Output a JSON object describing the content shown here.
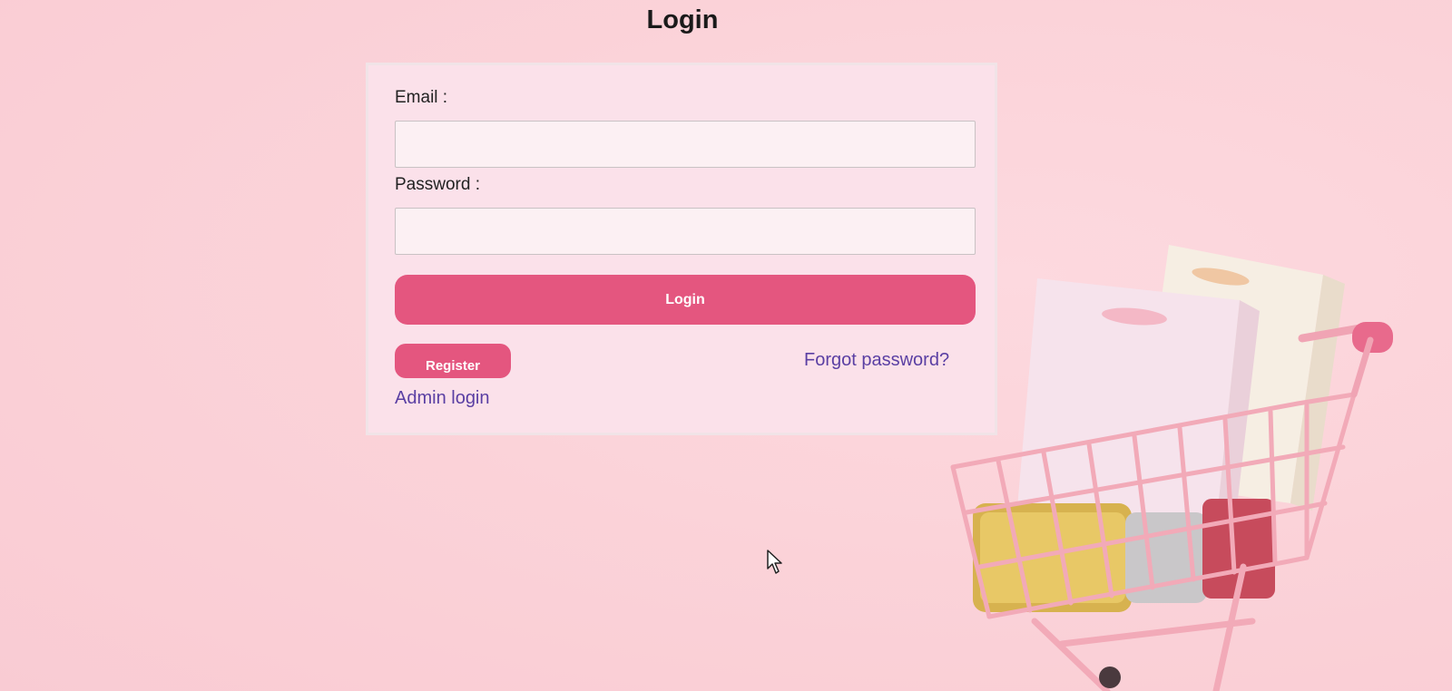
{
  "page": {
    "title": "Login"
  },
  "form": {
    "email_label": "Email :",
    "email_value": "",
    "password_label": "Password :",
    "password_value": "",
    "login_button": "Login",
    "register_button": "Register",
    "forgot_password_link": "Forgot password?",
    "admin_login_link": "Admin login"
  },
  "theme": {
    "background": "#fbd3d9",
    "card_background": "#fbe1ea",
    "button_color": "#e4567f",
    "link_color": "#5a3fa3"
  },
  "decor": {
    "illustration": "shopping-cart-with-bags",
    "cursor": "mouse-pointer-icon"
  }
}
